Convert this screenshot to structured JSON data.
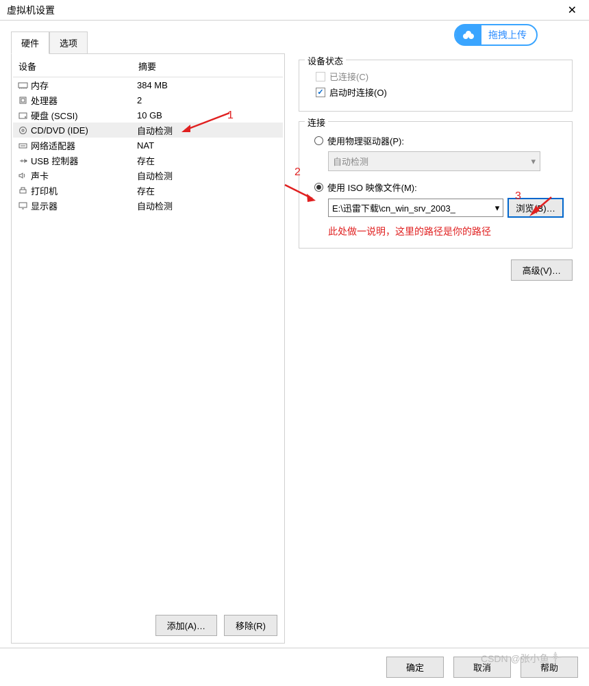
{
  "title": "虚拟机设置",
  "upload_button": "拖拽上传",
  "tabs": {
    "hardware": "硬件",
    "options": "选项"
  },
  "list": {
    "header_device": "设备",
    "header_summary": "摘要",
    "rows": [
      {
        "icon": "memory",
        "label": "内存",
        "summary": "384 MB"
      },
      {
        "icon": "cpu",
        "label": "处理器",
        "summary": "2"
      },
      {
        "icon": "disk",
        "label": "硬盘 (SCSI)",
        "summary": "10 GB"
      },
      {
        "icon": "cd",
        "label": "CD/DVD (IDE)",
        "summary": "自动检测"
      },
      {
        "icon": "net",
        "label": "网络适配器",
        "summary": "NAT"
      },
      {
        "icon": "usb",
        "label": "USB 控制器",
        "summary": "存在"
      },
      {
        "icon": "sound",
        "label": "声卡",
        "summary": "自动检测"
      },
      {
        "icon": "printer",
        "label": "打印机",
        "summary": "存在"
      },
      {
        "icon": "display",
        "label": "显示器",
        "summary": "自动检测"
      }
    ],
    "add_btn": "添加(A)…",
    "remove_btn": "移除(R)"
  },
  "status": {
    "legend": "设备状态",
    "connected": "已连接(C)",
    "connect_on_start": "启动时连接(O)"
  },
  "connection": {
    "legend": "连接",
    "physical_drive": "使用物理驱动器(P):",
    "auto_detect": "自动检测",
    "use_iso": "使用 ISO 映像文件(M):",
    "iso_path": "E:\\迅雷下载\\cn_win_srv_2003_",
    "browse": "浏览(B)…"
  },
  "annotation": "此处做一说明，这里的路径是你的路径",
  "labels": {
    "one": "1",
    "two": "2",
    "three": "3"
  },
  "advanced": "高级(V)…",
  "footer": {
    "ok": "确定",
    "cancel": "取消",
    "help": "帮助"
  },
  "watermark": "CSDN @张小鱼༒"
}
